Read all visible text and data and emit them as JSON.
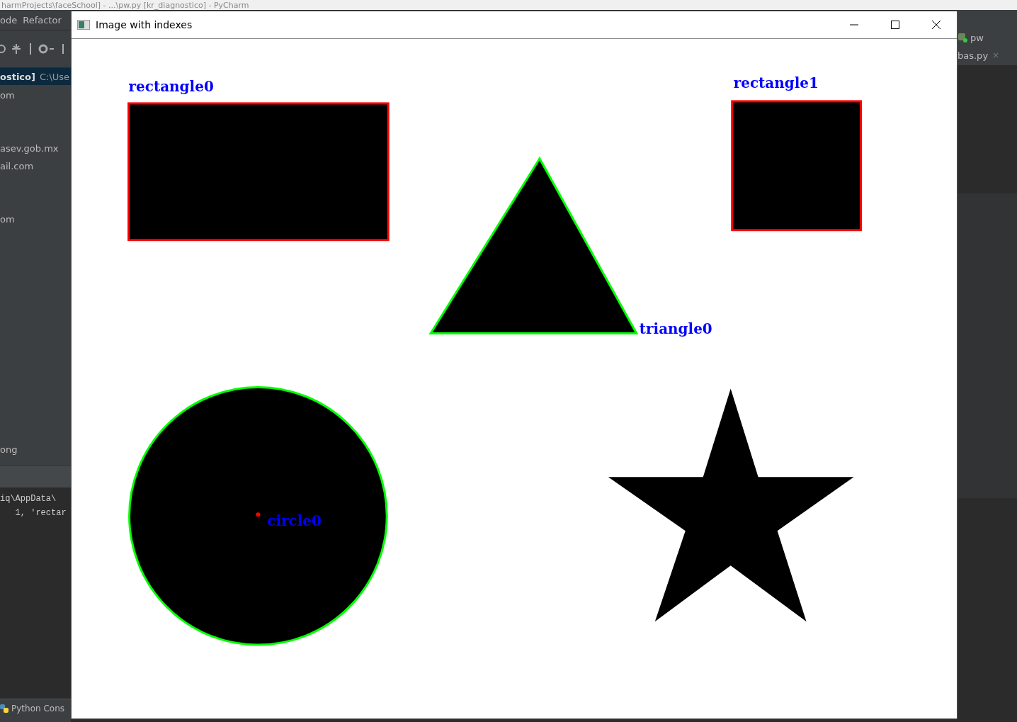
{
  "ide": {
    "title": "harmProjects\\faceSchool] - ...\\pw.py [kr_diagnostico] - PyCharm",
    "menu": [
      "ode",
      "Refactor"
    ],
    "project_header": {
      "name": "ostico]",
      "path": "C:\\Use"
    },
    "tree_items": [
      "om",
      "asev.gob.mx",
      "ail.com",
      "om",
      "ong"
    ],
    "console_lines": [
      "iq\\AppData\\",
      "   1, 'rectar"
    ],
    "console_tab": "Python Cons",
    "run_config": "pw",
    "editor_tab": {
      "label": "bas.py",
      "close": "×"
    }
  },
  "window": {
    "title": "Image with indexes",
    "shapes": [
      {
        "kind": "rectangle",
        "label": "rectangle0",
        "color": "#ff0000"
      },
      {
        "kind": "triangle",
        "label": "triangle0",
        "color": "#00ff00"
      },
      {
        "kind": "rectangle",
        "label": "rectangle1",
        "color": "#ff0000"
      },
      {
        "kind": "circle",
        "label": "circle0",
        "color": "#00ff00"
      },
      {
        "kind": "star"
      }
    ]
  }
}
